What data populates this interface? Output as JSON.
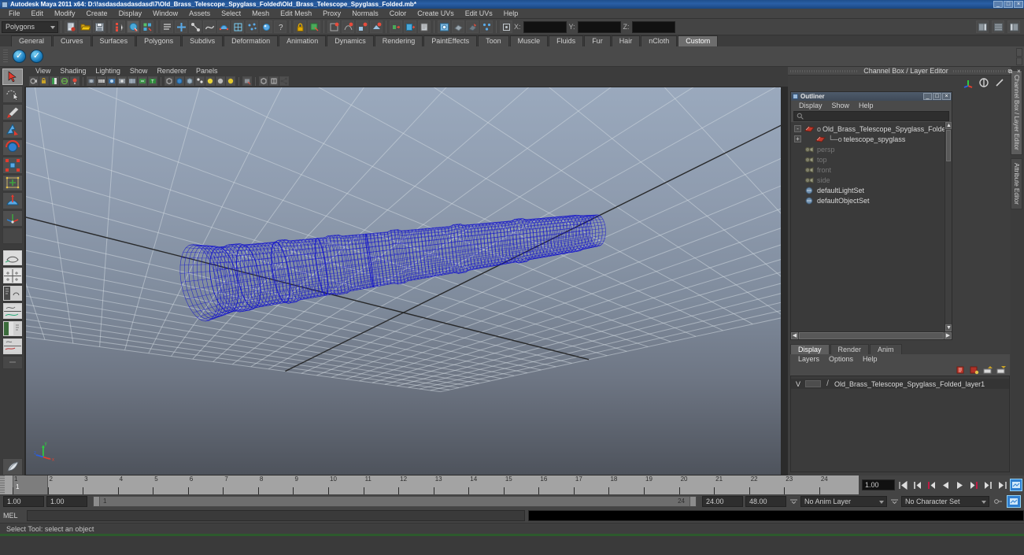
{
  "window": {
    "title": "Autodesk Maya 2011 x64: D:\\!asdasdasdasdasd\\7\\Old_Brass_Telescope_Spyglass_Folded\\Old_Brass_Telescope_Spyglass_Folded.mb*",
    "minimize": "_",
    "maximize": "□",
    "close": "×"
  },
  "menubar": {
    "items": [
      "File",
      "Edit",
      "Modify",
      "Create",
      "Display",
      "Window",
      "Assets",
      "Select",
      "Mesh",
      "Edit Mesh",
      "Proxy",
      "Normals",
      "Color",
      "Create UVs",
      "Edit UVs",
      "Help"
    ]
  },
  "statusbar": {
    "menuset": "Polygons",
    "coord_labels": [
      "X:",
      "Y:",
      "Z:"
    ],
    "coord_values": [
      "",
      "",
      ""
    ],
    "icons": [
      "new-scene-icon",
      "open-scene-icon",
      "save-scene-icon",
      "select-hierarchy-icon",
      "select-object-icon",
      "select-component-icon",
      "select-by-outliner-icon",
      "select-by-handle-icon",
      "select-by-ik-icon",
      "select-by-curve-icon",
      "select-by-surface-icon",
      "select-by-deform-icon",
      "select-by-dynamic-icon",
      "select-by-render-icon",
      "select-by-misc-icon",
      "lock-selection-icon",
      "highlight-selection-icon",
      "snap-to-grid-icon",
      "snap-to-curve-icon",
      "snap-to-point-icon",
      "snap-to-plane-icon",
      "construction-history-icon",
      "render-current-frame-icon",
      "ipr-render-icon",
      "render-settings-icon",
      "show-hide-editors-icon",
      "attribute-editor-icon",
      "tool-settings-icon",
      "channel-box-icon",
      "input-line-mode-icon"
    ]
  },
  "shelf": {
    "tabs": [
      "General",
      "Curves",
      "Surfaces",
      "Polygons",
      "Subdivs",
      "Deformation",
      "Animation",
      "Dynamics",
      "Rendering",
      "PaintEffects",
      "Toon",
      "Muscle",
      "Fluids",
      "Fur",
      "Hair",
      "nCloth",
      "Custom"
    ],
    "active_tab": "Custom",
    "buttons": [
      "custom-shelf-item-1",
      "custom-shelf-item-2"
    ]
  },
  "toolbox": {
    "tools": [
      {
        "name": "select-tool",
        "selected": true
      },
      {
        "name": "lasso-select-tool",
        "selected": false
      },
      {
        "name": "paint-select-tool",
        "selected": false
      },
      {
        "name": "move-tool",
        "selected": false
      },
      {
        "name": "rotate-tool",
        "selected": false
      },
      {
        "name": "scale-tool",
        "selected": false
      },
      {
        "name": "universal-manipulator-tool",
        "selected": false
      },
      {
        "name": "soft-modification-tool",
        "selected": false
      },
      {
        "name": "show-manipulator-tool",
        "selected": false
      },
      {
        "name": "last-tool-used",
        "selected": false
      },
      {
        "name": "single-perspective-layout",
        "selected": false
      },
      {
        "name": "four-view-layout",
        "selected": false
      },
      {
        "name": "persp-outliner-layout",
        "selected": false
      },
      {
        "name": "persp-graph-layout",
        "selected": false
      },
      {
        "name": "persp-hypershade-layout",
        "selected": false
      },
      {
        "name": "persp-render-layout",
        "selected": false
      },
      {
        "name": "saved-layout-extra",
        "selected": false
      },
      {
        "name": "paint-effects-tool",
        "selected": false
      }
    ]
  },
  "viewport": {
    "menus": [
      "View",
      "Shading",
      "Lighting",
      "Show",
      "Renderer",
      "Panels"
    ],
    "toolbar_icons": [
      "select-camera-icon",
      "lock-camera-icon",
      "bookmark-icon",
      "image-plane-icon",
      "two-sided-lighting-icon",
      "smooth-shade-icon",
      "wireframe-on-shaded-icon",
      "xray-icon",
      "xray-joints-icon",
      "texture-icon",
      "hw-texture-icon",
      "hq-render-icon",
      "isolate-select-icon",
      "shadows-icon",
      "light-icon",
      "default-light-icon",
      "all-lights-icon",
      "grid-icon",
      "film-gate-icon",
      "resolution-gate-icon",
      "exposure-icon"
    ],
    "axis_labels": {
      "x": "x",
      "y": "y",
      "z": "z"
    },
    "model_name": "telescope_spyglass",
    "wireframe_color": "#1111cc",
    "bg_top": "#9aa9bd",
    "bg_bottom": "#4e535c"
  },
  "channelbox": {
    "title": "Channel Box / Layer Editor",
    "restore": "⧉",
    "close": "×",
    "icons": [
      "manipulator-icon",
      "toggle-icon",
      "pencil-icon"
    ]
  },
  "outliner": {
    "title": "Outliner",
    "minimize": "_",
    "maximize": "□",
    "close": "×",
    "menus": [
      "Display",
      "Show",
      "Help"
    ],
    "search_value": "",
    "rows": [
      {
        "expand": "-",
        "label": "Old_Brass_Telescope_Spyglass_Folded",
        "icon": "transform-icon",
        "dim": false,
        "indent": 0,
        "connector": "o"
      },
      {
        "expand": "+",
        "label": "telescope_spyglass",
        "icon": "transform-icon",
        "dim": false,
        "indent": 1,
        "connector": "o"
      },
      {
        "expand": "",
        "label": "persp",
        "icon": "camera-icon",
        "dim": true,
        "indent": 0,
        "connector": ""
      },
      {
        "expand": "",
        "label": "top",
        "icon": "camera-icon",
        "dim": true,
        "indent": 0,
        "connector": ""
      },
      {
        "expand": "",
        "label": "front",
        "icon": "camera-icon",
        "dim": true,
        "indent": 0,
        "connector": ""
      },
      {
        "expand": "",
        "label": "side",
        "icon": "camera-icon",
        "dim": true,
        "indent": 0,
        "connector": ""
      },
      {
        "expand": "",
        "label": "defaultLightSet",
        "icon": "set-icon",
        "dim": false,
        "indent": 0,
        "connector": ""
      },
      {
        "expand": "",
        "label": "defaultObjectSet",
        "icon": "set-icon",
        "dim": false,
        "indent": 0,
        "connector": ""
      }
    ]
  },
  "layereditor": {
    "tabs": [
      "Display",
      "Render",
      "Anim"
    ],
    "active_tab": "Display",
    "menus": [
      "Layers",
      "Options",
      "Help"
    ],
    "icons": [
      "new-layer-icon",
      "new-layer-from-selected-icon",
      "layer-up-icon",
      "layer-down-icon"
    ],
    "layers": [
      {
        "visibility": "V",
        "color_swatch": "",
        "playback": "/",
        "name": "Old_Brass_Telescope_Spyglass_Folded_layer1"
      }
    ]
  },
  "vertical_tabs": [
    {
      "label": "Channel Box / Layer Editor",
      "active": true
    },
    {
      "label": "Attribute Editor",
      "active": false
    }
  ],
  "timeline": {
    "ticks": [
      1,
      2,
      3,
      4,
      5,
      6,
      7,
      8,
      9,
      10,
      11,
      12,
      13,
      14,
      15,
      16,
      17,
      18,
      19,
      20,
      21,
      22,
      23,
      24
    ],
    "current_frame_label": "1",
    "current_time_field": "1.00",
    "playback_buttons": [
      "go-to-start-icon",
      "step-back-frame-icon",
      "step-back-key-icon",
      "play-backwards-icon",
      "play-forwards-icon",
      "step-forward-key-icon",
      "step-forward-frame-icon",
      "go-to-end-icon"
    ],
    "anim_prefs_icon": "animation-preferences-icon"
  },
  "rangeslider": {
    "anim_start": "1.00",
    "range_start": "1.00",
    "slider_left_value": "1",
    "slider_right_value": "24",
    "range_end": "24.00",
    "anim_end": "48.00",
    "anim_layer": "No Anim Layer",
    "character_set": "No Character Set",
    "auto_key_icon": "auto-keyframe-icon",
    "anim_prefs_icon": "animation-preferences-icon"
  },
  "commandline": {
    "label": "MEL",
    "input_value": "",
    "output_value": ""
  },
  "helpline": {
    "text": "Select Tool: select an object"
  }
}
